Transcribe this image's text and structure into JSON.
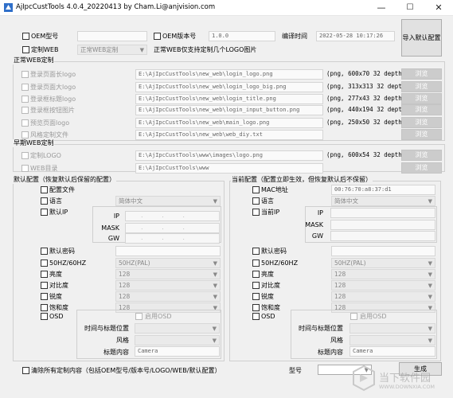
{
  "window": {
    "title": "AjIpcCustTools 4.0.4_20220413 by Cham.Li@anjvision.com",
    "min": "—",
    "max": "☐",
    "close": "✕"
  },
  "top": {
    "oem_model_label": "OEM型号",
    "oem_version_label": "OEM版本号",
    "oem_version_value": "1.0.0",
    "compile_time_label": "编译时间",
    "compile_time_value": "2022-05-28 10:17:26",
    "import_button": "导入默认配置",
    "custom_web_label": "定制WEB",
    "custom_web_select": "正常WEB定制",
    "custom_web_hint": "正常WEB仅支持定制几个LOGO图片"
  },
  "normal_web": {
    "title": "正常WEB定制",
    "browse": "浏览",
    "rows": [
      {
        "label": "登录页面长logo",
        "path": "E:\\AjIpcCustTools\\new_web\\login_logo.png",
        "info": "(png, 600x70 32 depth)"
      },
      {
        "label": "登录页面大logo",
        "path": "E:\\AjIpcCustTools\\new_web\\login_logo_big.png",
        "info": "(png, 313x313 32 depth)"
      },
      {
        "label": "登录框标题logo",
        "path": "E:\\AjIpcCustTools\\new_web\\login_title.png",
        "info": "(png, 277x43 32 depth)"
      },
      {
        "label": "登录框按钮图片",
        "path": "E:\\AjIpcCustTools\\new_web\\login_input_button.png",
        "info": "(png, 440x194 32 depth)"
      },
      {
        "label": "预览页面logo",
        "path": "E:\\AjIpcCustTools\\new_web\\main_logo.png",
        "info": "(png, 250x50 32 depth)"
      },
      {
        "label": "风格定制文件",
        "path": "E:\\AjIpcCustTools\\new_web\\web_diy.txt",
        "info": ""
      }
    ]
  },
  "early_web": {
    "title": "早期WEB定制",
    "rows": [
      {
        "label": "定制LOGO",
        "path": "E:\\AjIpcCustTools\\www\\images\\logo.png",
        "info": "(png, 600x54 32 depth)"
      },
      {
        "label": "WEB目录",
        "path": "E:\\AjIpcCustTools\\www",
        "info": ""
      }
    ]
  },
  "default_cfg": {
    "title": "默认配置（恢复默认后保留的配置）",
    "config_file": "配置文件",
    "language": "语言",
    "language_value": "简体中文",
    "default_ip": "默认IP",
    "ip": "IP",
    "mask": "MASK",
    "gw": "GW",
    "ip_dots": "...",
    "default_password": "默认密码",
    "video_std": "50HZ/60HZ",
    "video_std_value": "50HZ(PAL)",
    "brightness": "亮度",
    "contrast": "对比度",
    "sharpness": "锐度",
    "saturation": "饱和度",
    "value_128": "128",
    "osd": "OSD",
    "enable_osd": "启用OSD",
    "time_title_pos": "时间与标题位置",
    "style": "风格",
    "title_content": "标题内容",
    "title_content_value": "Camera"
  },
  "current_cfg": {
    "title": "当前配置（配置立即生效，但恢复默认后不保留）",
    "mac": "MAC地址",
    "mac_value": "00:76:70:a8:37:d1",
    "language": "语言",
    "language_value": "简体中文",
    "current_ip": "当前IP",
    "ip": "IP",
    "mask": "MASK",
    "gw": "GW",
    "default_password": "默认密码",
    "video_std": "50HZ/60HZ",
    "video_std_value": "50HZ(PAL)",
    "brightness": "亮度",
    "contrast": "对比度",
    "sharpness": "锐度",
    "saturation": "饱和度",
    "value_128": "128",
    "osd": "OSD",
    "enable_osd": "启用OSD",
    "time_title_pos": "时间与标题位置",
    "style": "风格",
    "title_content": "标题内容",
    "title_content_value": "Camera"
  },
  "bottom": {
    "clear_label": "清除所有定制内容（包括OEM型号/版本号/LOGO/WEB/默认配置）",
    "model_label": "型号",
    "generate_button": "生成"
  },
  "watermark": {
    "text": "当下软件园",
    "sub": "WWW.DOWNXIA.COM"
  }
}
